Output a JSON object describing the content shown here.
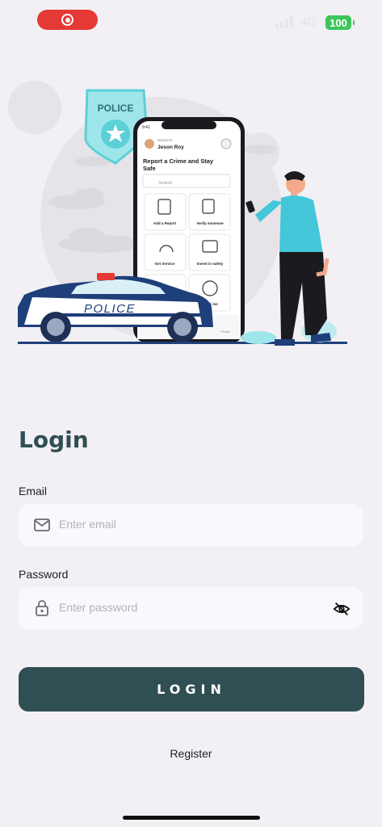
{
  "status_bar": {
    "network": "4G",
    "battery": "100",
    "colors": {
      "recording": "#e53935",
      "battery": "#3cc65a"
    }
  },
  "illustration": {
    "badge_text": "POLICE",
    "car_text": "POLICE",
    "phone": {
      "time": "9:41",
      "welcome": "Welcome",
      "user_name": "Jeson Roy",
      "heading": "Report a Crime and Stay Safe",
      "search_placeholder": "Search",
      "tiles": [
        "Add a Report",
        "Verify someone",
        "Get Service",
        "Invest in safety",
        "",
        "Track me"
      ],
      "nav_label": "Profile"
    }
  },
  "login": {
    "title": "Login",
    "email_label": "Email",
    "email_placeholder": "Enter email",
    "password_label": "Password",
    "password_placeholder": "Enter password",
    "button_label": "LOGIN",
    "register_label": "Register"
  },
  "theme": {
    "primary": "#2f4f52",
    "background": "#f2f0f4",
    "accent": "#5bd0d6",
    "field": "#faf8fc"
  },
  "icons": [
    "record-icon",
    "signal-icon",
    "mail-icon",
    "lock-icon",
    "eye-off-icon"
  ]
}
